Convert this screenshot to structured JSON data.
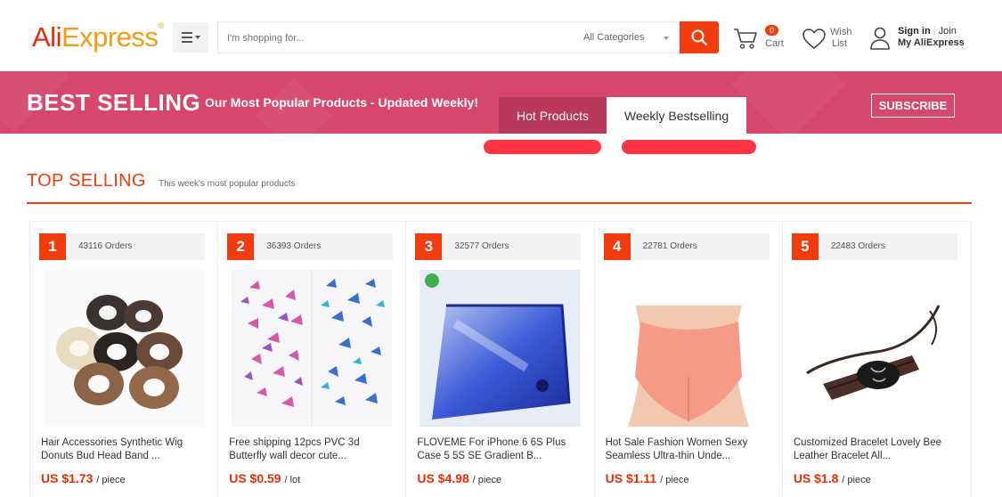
{
  "header": {
    "logo": {
      "part1": "Ali",
      "part2": "Express",
      "reg": "®"
    },
    "search_placeholder": "I'm shopping for...",
    "category": "All Categories",
    "cart_count": "0",
    "cart_label": "Cart",
    "wish_line1": "Wish",
    "wish_line2": "List",
    "sign_in": "Sign in",
    "join": "Join",
    "my_account": "My AliExpress",
    "accent_color": "#f33c0d"
  },
  "banner": {
    "title": "BEST SELLING",
    "subtitle": "Our Most Popular Products - Updated Weekly!",
    "tabs": [
      "Hot Products",
      "Weekly Bestselling"
    ],
    "active_tab": "Weekly Bestselling",
    "subscribe": "SUBSCRIBE",
    "color": "#d6476b"
  },
  "section": {
    "title": "TOP SELLING",
    "subtitle": "This week's most popular products"
  },
  "products": [
    {
      "rank": "1",
      "orders": "43116 Orders",
      "title": "Hair Accessories Synthetic Wig Donuts Bud Head Band ...",
      "price": "US $1.73",
      "unit": "/ piece",
      "image": "hair-donuts"
    },
    {
      "rank": "2",
      "orders": "36393 Orders",
      "title": "Free shipping 12pcs PVC 3d Butterfly wall decor cute...",
      "price": "US $0.59",
      "unit": "/ lot",
      "image": "butterflies"
    },
    {
      "rank": "3",
      "orders": "32577 Orders",
      "title": "FLOVEME For iPhone 6 6S Plus Case 5 5S SE Gradient B...",
      "price": "US $4.98",
      "unit": "/ piece",
      "image": "phone-case"
    },
    {
      "rank": "4",
      "orders": "22781 Orders",
      "title": "Hot Sale Fashion Women Sexy Seamless Ultra-thin Unde...",
      "price": "US $1.11",
      "unit": "/ piece",
      "image": "underwear"
    },
    {
      "rank": "5",
      "orders": "22483 Orders",
      "title": "Customized Bracelet Lovely Bee Leather Bracelet All...",
      "price": "US $1.8",
      "unit": "/ piece",
      "image": "bracelet"
    }
  ]
}
